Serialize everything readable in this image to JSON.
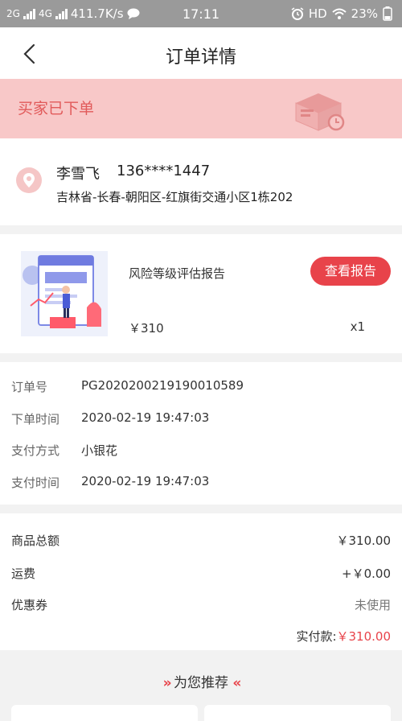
{
  "status_bar": {
    "sim1": "2G",
    "sim2": "4G",
    "speed": "411.7K/s",
    "time": "17:11",
    "hd": "HD",
    "battery": "23%"
  },
  "nav": {
    "title": "订单详情"
  },
  "banner": {
    "status_text": "买家已下单"
  },
  "address": {
    "name": "李雪飞",
    "phone": "136****1447",
    "detail": "吉林省-长春-朝阳区-红旗街交通小区1栋202"
  },
  "product": {
    "name": "风险等级评估报告",
    "button_label": "查看报告",
    "price": "￥310",
    "quantity": "x1"
  },
  "order_info": [
    {
      "label": "订单号",
      "value": "PG2020200219190010589"
    },
    {
      "label": "下单时间",
      "value": "2020-02-19 19:47:03"
    },
    {
      "label": "支付方式",
      "value": "小银花"
    },
    {
      "label": "支付时间",
      "value": "2020-02-19 19:47:03"
    }
  ],
  "summary": {
    "rows": [
      {
        "label": "商品总额",
        "value": "￥310.00"
      },
      {
        "label": "运费",
        "value": "+￥0.00"
      },
      {
        "label": "优惠券",
        "value": "未使用"
      }
    ],
    "paid_label": "实付款:",
    "paid_amount": "￥310.00"
  },
  "recommend": {
    "title": "为您推荐"
  },
  "colors": {
    "accent_red": "#e8434a",
    "banner_bg": "#f8c8c8",
    "banner_text": "#e15a5a"
  }
}
